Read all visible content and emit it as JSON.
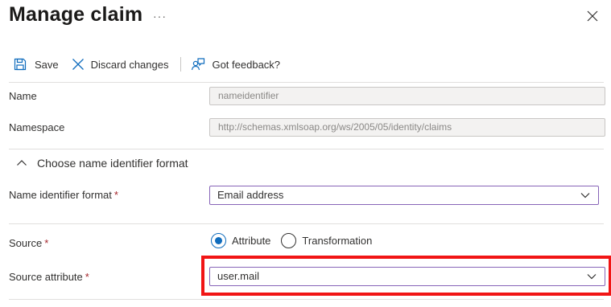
{
  "header": {
    "title": "Manage claim",
    "more": "···"
  },
  "toolbar": {
    "save_label": "Save",
    "discard_label": "Discard changes",
    "feedback_label": "Got feedback?"
  },
  "fields": {
    "name": {
      "label": "Name",
      "value": "nameidentifier"
    },
    "namespace": {
      "label": "Namespace",
      "value": "http://schemas.xmlsoap.org/ws/2005/05/identity/claims"
    }
  },
  "section": {
    "title": "Choose name identifier format"
  },
  "name_id_format": {
    "label": "Name identifier format",
    "required_mark": "*",
    "selected": "Email address"
  },
  "source": {
    "label": "Source",
    "required_mark": "*",
    "options": [
      {
        "label": "Attribute",
        "checked": true
      },
      {
        "label": "Transformation",
        "checked": false
      }
    ]
  },
  "source_attribute": {
    "label": "Source attribute",
    "required_mark": "*",
    "selected": "user.mail"
  },
  "colors": {
    "accent": "#0f6cbd",
    "dropdown_border": "#8764b8",
    "highlight": "#f11515",
    "required": "#a4262c"
  },
  "icons": [
    "close-icon",
    "save-icon",
    "discard-icon",
    "feedback-icon",
    "chevron-up-icon",
    "chevron-down-icon"
  ]
}
